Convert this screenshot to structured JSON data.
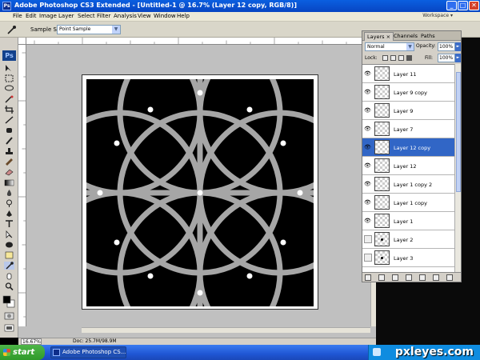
{
  "window": {
    "title": "Adobe Photoshop CS3 Extended - [Untitled-1 @ 16.7% (Layer 12 copy, RGB/8)]",
    "min_glyph": "_",
    "max_glyph": "□",
    "close_glyph": "✕"
  },
  "menu": {
    "items": [
      "File",
      "Edit",
      "Image",
      "Layer",
      "Select",
      "Filter",
      "Analysis",
      "View",
      "Window",
      "Help"
    ],
    "workspace_label": "Workspace ▾"
  },
  "options": {
    "sample_size_label": "Sample Size:",
    "sample_size_value": "Point Sample"
  },
  "toolbar": {
    "logo": "Ps"
  },
  "status": {
    "zoom": "16.67%",
    "doc": "Doc: 25.7M/98.9M"
  },
  "layers_panel": {
    "tabs": [
      "Layers",
      "Channels",
      "Paths"
    ],
    "tab_close": "×",
    "blend_mode": "Normal",
    "opacity_label": "Opacity:",
    "opacity_value": "100%",
    "lock_label": "Lock:",
    "fill_label": "Fill:",
    "fill_value": "100%",
    "layers": [
      {
        "name": "Layer 11",
        "visible": true,
        "selected": false
      },
      {
        "name": "Layer 9 copy",
        "visible": true,
        "selected": false
      },
      {
        "name": "Layer 9",
        "visible": true,
        "selected": false
      },
      {
        "name": "Layer 7",
        "visible": true,
        "selected": false
      },
      {
        "name": "Layer 12 copy",
        "visible": true,
        "selected": true
      },
      {
        "name": "Layer 12",
        "visible": true,
        "selected": false
      },
      {
        "name": "Layer 1 copy 2",
        "visible": true,
        "selected": false
      },
      {
        "name": "Layer 1 copy",
        "visible": true,
        "selected": false
      },
      {
        "name": "Layer 1",
        "visible": true,
        "selected": false
      },
      {
        "name": "Layer 2",
        "visible": false,
        "selected": false
      },
      {
        "name": "Layer 3",
        "visible": false,
        "selected": false
      }
    ]
  },
  "taskbar": {
    "start_label": "start",
    "task_item": "Adobe Photoshop CS...",
    "watermark": "pxleyes.com"
  },
  "colors": {
    "canvas_bg": "#000000",
    "pattern_stroke": "#a6a6a6",
    "dot": "#ffffff",
    "selection": "#3166c6"
  }
}
